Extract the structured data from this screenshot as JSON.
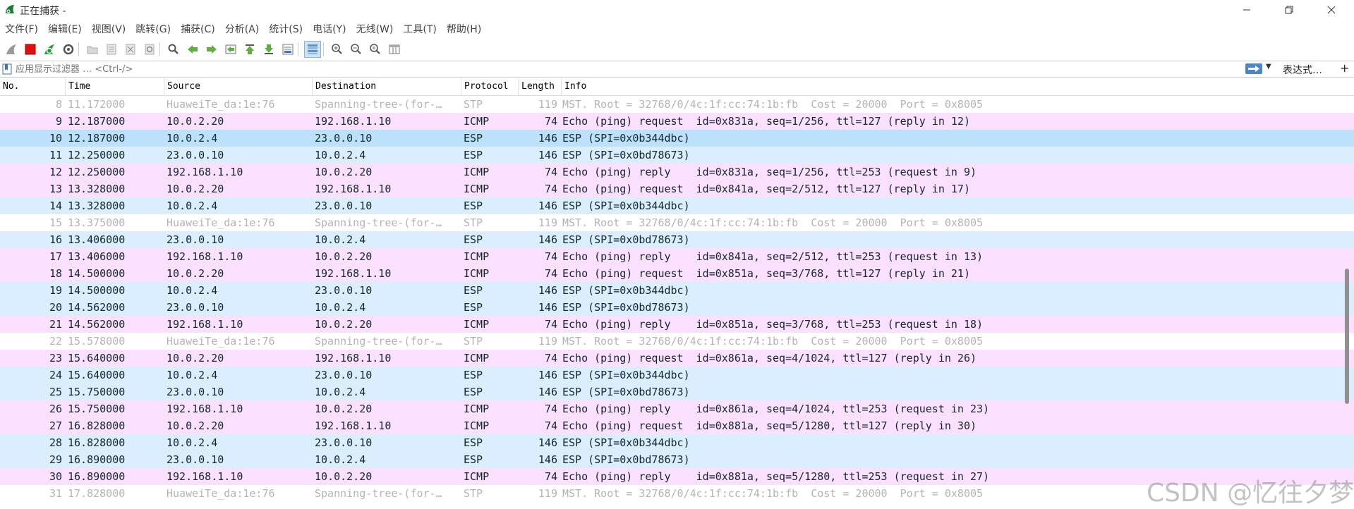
{
  "window": {
    "title": "正在捕获 -"
  },
  "menu": [
    "文件(F)",
    "编辑(E)",
    "视图(V)",
    "跳转(G)",
    "捕获(C)",
    "分析(A)",
    "统计(S)",
    "电话(Y)",
    "无线(W)",
    "工具(T)",
    "帮助(H)"
  ],
  "toolbar_icons": [
    "shark-fin-icon",
    "stop-icon",
    "restart-icon",
    "options-gear-icon",
    "open-folder-icon",
    "save-file-icon",
    "close-file-icon",
    "reload-icon",
    "find-icon",
    "back-arrow-icon",
    "forward-arrow-icon",
    "go-to-packet-icon",
    "first-packet-icon",
    "last-packet-icon",
    "autoscroll-icon",
    "colorize-icon",
    "zoom-in-icon",
    "zoom-out-icon",
    "zoom-normal-icon",
    "resize-columns-icon"
  ],
  "filter": {
    "placeholder": "应用显示过滤器 … <Ctrl-/>",
    "expression_label": "表达式…",
    "add_label": "+"
  },
  "columns": [
    "No.",
    "Time",
    "Source",
    "Destination",
    "Protocol",
    "Length",
    "Info"
  ],
  "rows": [
    {
      "no": "8",
      "time": "11.172000",
      "src": "HuaweiTe_da:1e:76",
      "dst": "Spanning-tree-(for-…",
      "proto": "STP",
      "len": "119",
      "info": "MST. Root = 32768/0/4c:1f:cc:74:1b:fb  Cost = 20000  Port = 0x8005",
      "type": "stp"
    },
    {
      "no": "9",
      "time": "12.187000",
      "src": "10.0.2.20",
      "dst": "192.168.1.10",
      "proto": "ICMP",
      "len": "74",
      "info": "Echo (ping) request  id=0x831a, seq=1/256, ttl=127 (reply in 12)",
      "type": "icmp"
    },
    {
      "no": "10",
      "time": "12.187000",
      "src": "10.0.2.4",
      "dst": "23.0.0.10",
      "proto": "ESP",
      "len": "146",
      "info": "ESP (SPI=0x0b344dbc)",
      "type": "esp selected"
    },
    {
      "no": "11",
      "time": "12.250000",
      "src": "23.0.0.10",
      "dst": "10.0.2.4",
      "proto": "ESP",
      "len": "146",
      "info": "ESP (SPI=0x0bd78673)",
      "type": "esp"
    },
    {
      "no": "12",
      "time": "12.250000",
      "src": "192.168.1.10",
      "dst": "10.0.2.20",
      "proto": "ICMP",
      "len": "74",
      "info": "Echo (ping) reply    id=0x831a, seq=1/256, ttl=253 (request in 9)",
      "type": "icmp"
    },
    {
      "no": "13",
      "time": "13.328000",
      "src": "10.0.2.20",
      "dst": "192.168.1.10",
      "proto": "ICMP",
      "len": "74",
      "info": "Echo (ping) request  id=0x841a, seq=2/512, ttl=127 (reply in 17)",
      "type": "icmp"
    },
    {
      "no": "14",
      "time": "13.328000",
      "src": "10.0.2.4",
      "dst": "23.0.0.10",
      "proto": "ESP",
      "len": "146",
      "info": "ESP (SPI=0x0b344dbc)",
      "type": "esp"
    },
    {
      "no": "15",
      "time": "13.375000",
      "src": "HuaweiTe_da:1e:76",
      "dst": "Spanning-tree-(for-…",
      "proto": "STP",
      "len": "119",
      "info": "MST. Root = 32768/0/4c:1f:cc:74:1b:fb  Cost = 20000  Port = 0x8005",
      "type": "stp"
    },
    {
      "no": "16",
      "time": "13.406000",
      "src": "23.0.0.10",
      "dst": "10.0.2.4",
      "proto": "ESP",
      "len": "146",
      "info": "ESP (SPI=0x0bd78673)",
      "type": "esp"
    },
    {
      "no": "17",
      "time": "13.406000",
      "src": "192.168.1.10",
      "dst": "10.0.2.20",
      "proto": "ICMP",
      "len": "74",
      "info": "Echo (ping) reply    id=0x841a, seq=2/512, ttl=253 (request in 13)",
      "type": "icmp"
    },
    {
      "no": "18",
      "time": "14.500000",
      "src": "10.0.2.20",
      "dst": "192.168.1.10",
      "proto": "ICMP",
      "len": "74",
      "info": "Echo (ping) request  id=0x851a, seq=3/768, ttl=127 (reply in 21)",
      "type": "icmp"
    },
    {
      "no": "19",
      "time": "14.500000",
      "src": "10.0.2.4",
      "dst": "23.0.0.10",
      "proto": "ESP",
      "len": "146",
      "info": "ESP (SPI=0x0b344dbc)",
      "type": "esp"
    },
    {
      "no": "20",
      "time": "14.562000",
      "src": "23.0.0.10",
      "dst": "10.0.2.4",
      "proto": "ESP",
      "len": "146",
      "info": "ESP (SPI=0x0bd78673)",
      "type": "esp"
    },
    {
      "no": "21",
      "time": "14.562000",
      "src": "192.168.1.10",
      "dst": "10.0.2.20",
      "proto": "ICMP",
      "len": "74",
      "info": "Echo (ping) reply    id=0x851a, seq=3/768, ttl=253 (request in 18)",
      "type": "icmp"
    },
    {
      "no": "22",
      "time": "15.578000",
      "src": "HuaweiTe_da:1e:76",
      "dst": "Spanning-tree-(for-…",
      "proto": "STP",
      "len": "119",
      "info": "MST. Root = 32768/0/4c:1f:cc:74:1b:fb  Cost = 20000  Port = 0x8005",
      "type": "stp"
    },
    {
      "no": "23",
      "time": "15.640000",
      "src": "10.0.2.20",
      "dst": "192.168.1.10",
      "proto": "ICMP",
      "len": "74",
      "info": "Echo (ping) request  id=0x861a, seq=4/1024, ttl=127 (reply in 26)",
      "type": "icmp"
    },
    {
      "no": "24",
      "time": "15.640000",
      "src": "10.0.2.4",
      "dst": "23.0.0.10",
      "proto": "ESP",
      "len": "146",
      "info": "ESP (SPI=0x0b344dbc)",
      "type": "esp"
    },
    {
      "no": "25",
      "time": "15.750000",
      "src": "23.0.0.10",
      "dst": "10.0.2.4",
      "proto": "ESP",
      "len": "146",
      "info": "ESP (SPI=0x0bd78673)",
      "type": "esp"
    },
    {
      "no": "26",
      "time": "15.750000",
      "src": "192.168.1.10",
      "dst": "10.0.2.20",
      "proto": "ICMP",
      "len": "74",
      "info": "Echo (ping) reply    id=0x861a, seq=4/1024, ttl=253 (request in 23)",
      "type": "icmp"
    },
    {
      "no": "27",
      "time": "16.828000",
      "src": "10.0.2.20",
      "dst": "192.168.1.10",
      "proto": "ICMP",
      "len": "74",
      "info": "Echo (ping) request  id=0x881a, seq=5/1280, ttl=127 (reply in 30)",
      "type": "icmp"
    },
    {
      "no": "28",
      "time": "16.828000",
      "src": "10.0.2.4",
      "dst": "23.0.0.10",
      "proto": "ESP",
      "len": "146",
      "info": "ESP (SPI=0x0b344dbc)",
      "type": "esp"
    },
    {
      "no": "29",
      "time": "16.890000",
      "src": "23.0.0.10",
      "dst": "10.0.2.4",
      "proto": "ESP",
      "len": "146",
      "info": "ESP (SPI=0x0bd78673)",
      "type": "esp"
    },
    {
      "no": "30",
      "time": "16.890000",
      "src": "192.168.1.10",
      "dst": "10.0.2.20",
      "proto": "ICMP",
      "len": "74",
      "info": "Echo (ping) reply    id=0x881a, seq=5/1280, ttl=253 (request in 27)",
      "type": "icmp"
    },
    {
      "no": "31",
      "time": "17.828000",
      "src": "HuaweiTe_da:1e:76",
      "dst": "Spanning-tree-(for-…",
      "proto": "STP",
      "len": "119",
      "info": "MST. Root = 32768/0/4c:1f:cc:74:1b:fb  Cost = 20000  Port = 0x8005",
      "type": "stp"
    }
  ],
  "watermark": "CSDN @忆往夕梦",
  "colors": {
    "icmp_row": "#fce0ff",
    "esp_row": "#daeeff",
    "stp_text": "#b4b4b4",
    "selected_row": "#bde1fb",
    "apply_button": "#4a86c8"
  }
}
